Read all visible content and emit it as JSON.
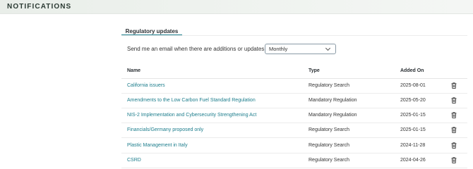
{
  "header": {
    "title": "NOTIFICATIONS"
  },
  "tabs": [
    {
      "label": "Regulatory updates",
      "active": true
    }
  ],
  "email_setting": {
    "label": "Send me an email when there are additions or updates:",
    "selected": "Monthly"
  },
  "table": {
    "columns": [
      "Name",
      "Type",
      "Added On"
    ],
    "rows": [
      {
        "name": "California issuers",
        "type": "Regulatory Search",
        "added_on": "2025-08-01"
      },
      {
        "name": "Amendments to the Low Carbon Fuel Standard Regulation",
        "type": "Mandatory Regulation",
        "added_on": "2025-05-20"
      },
      {
        "name": "NIS-2 Implementation and Cybersecurity Strengthening Act",
        "type": "Mandatory Regulation",
        "added_on": "2025-01-15"
      },
      {
        "name": "Financials/Germany proposed only",
        "type": "Regulatory Search",
        "added_on": "2025-01-15"
      },
      {
        "name": "Plastic Management in Italy",
        "type": "Regulatory Search",
        "added_on": "2024-11-28"
      },
      {
        "name": "CSRD",
        "type": "Regulatory Search",
        "added_on": "2024-04-26"
      }
    ]
  },
  "icons": {
    "row_action": "trash-icon",
    "select_arrow": "chevron-down-icon"
  },
  "colors": {
    "link": "#1c7d8c",
    "tab_underline": "#1c7d8c"
  }
}
